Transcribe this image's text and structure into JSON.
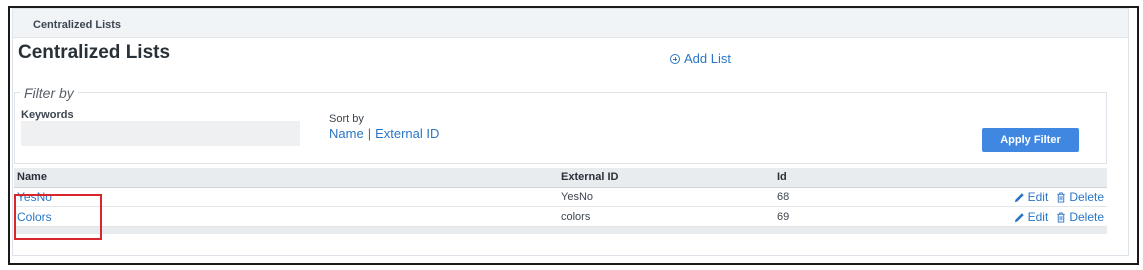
{
  "panel": {
    "header": "Centralized Lists",
    "title": "Centralized Lists"
  },
  "add_list": {
    "label": "Add List",
    "icon": "plus-circle-icon"
  },
  "filter": {
    "legend": "Filter by",
    "keywords_label": "Keywords",
    "keywords_value": "",
    "keywords_placeholder": "",
    "sort_label": "Sort by",
    "sort_name": "Name",
    "sort_separator": "|",
    "sort_external": "External ID",
    "apply_label": "Apply Filter"
  },
  "table": {
    "headers": {
      "name": "Name",
      "external_id": "External ID",
      "id": "Id"
    },
    "rows": [
      {
        "name": "YesNo",
        "external_id": "YesNo",
        "id": "68",
        "edit": "Edit",
        "delete": "Delete"
      },
      {
        "name": "Colors",
        "external_id": "colors",
        "id": "69",
        "edit": "Edit",
        "delete": "Delete"
      }
    ]
  },
  "colors": {
    "accent": "#2a76c6",
    "button": "#3f87e1",
    "highlight": "#d9262c"
  }
}
